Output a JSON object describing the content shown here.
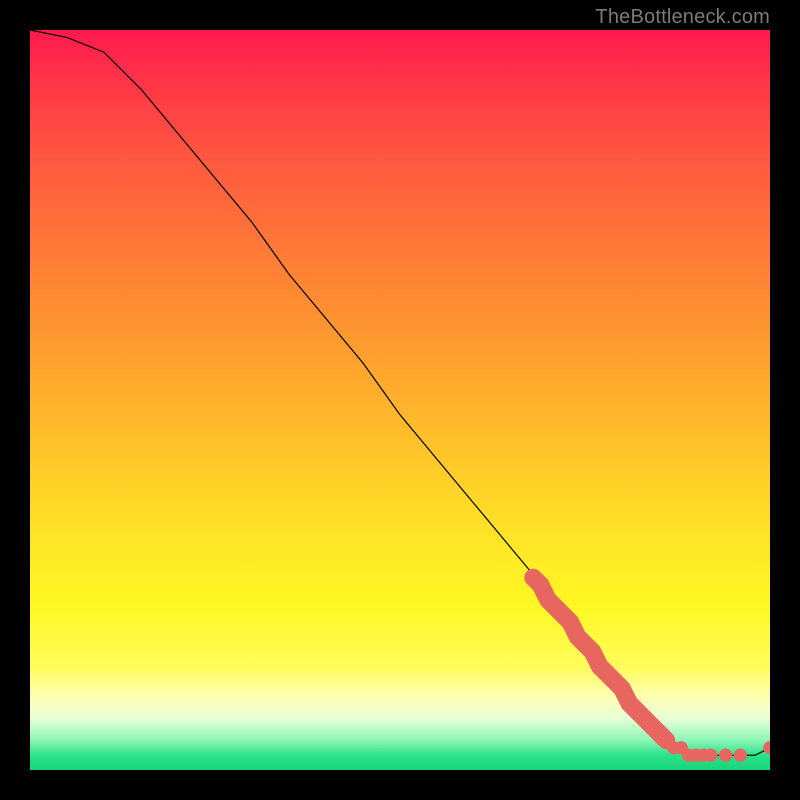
{
  "watermark": "TheBottleneck.com",
  "chart_data": {
    "type": "line",
    "title": "",
    "xlabel": "",
    "ylabel": "",
    "xlim": [
      0,
      100
    ],
    "ylim": [
      0,
      100
    ],
    "curve": {
      "name": "bottleneck-curve",
      "x": [
        0,
        5,
        10,
        15,
        20,
        25,
        30,
        35,
        40,
        45,
        50,
        55,
        60,
        65,
        70,
        75,
        80,
        82,
        84,
        86,
        90,
        92,
        94,
        96,
        98,
        100
      ],
      "y": [
        100,
        99,
        97,
        92,
        86,
        80,
        74,
        67,
        61,
        55,
        48,
        42,
        36,
        30,
        24,
        17,
        11,
        8,
        6,
        4,
        2,
        2,
        2,
        2,
        2,
        3
      ]
    },
    "points": {
      "name": "highlighted-segment",
      "x": [
        68,
        69,
        70,
        71,
        72,
        73,
        74,
        75,
        76,
        77,
        78,
        79,
        80,
        81,
        82,
        84,
        85,
        86,
        87,
        88,
        89,
        90,
        91,
        92,
        94,
        96,
        100
      ],
      "y": [
        26,
        25,
        23,
        22,
        21,
        20,
        18,
        17,
        16,
        14,
        13,
        12,
        11,
        9,
        8,
        6,
        5,
        4,
        3,
        3,
        2,
        2,
        2,
        2,
        2,
        2,
        3
      ]
    },
    "colors": {
      "curve": "#000000",
      "points": "#e86660"
    }
  }
}
